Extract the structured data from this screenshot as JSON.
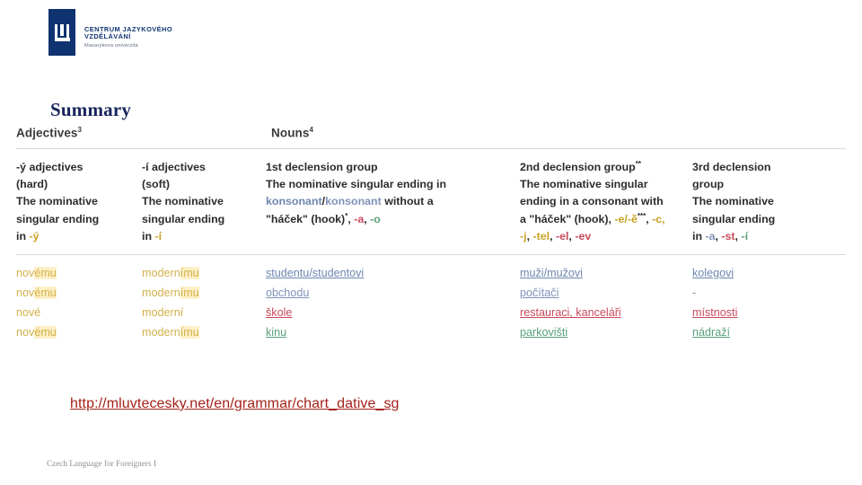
{
  "logo": {
    "line1": "CENTRUM JAZYKOVÉHO",
    "line2": "VZDĚLÁVÁNÍ",
    "line3": "Masarykova univerzita",
    "brand_color": "#0f3370"
  },
  "title": "Summary",
  "table": {
    "headers": {
      "adjectives": "Adjectives",
      "adjectives_sup": "3",
      "nouns": "Nouns",
      "nouns_sup": "4"
    },
    "descriptions": {
      "hard_adj": {
        "l1": "-ý adjectives",
        "l2": "(hard)",
        "l3": "The nominative",
        "l4": "singular ending",
        "l5_prefix": "in ",
        "l5_ending": "-ý"
      },
      "soft_adj": {
        "l1": "-í adjectives",
        "l2": "(soft)",
        "l3": "The nominative",
        "l4": "singular ending",
        "l5_prefix": "in ",
        "l5_ending": "-í"
      },
      "decl1": {
        "l1": "1st declension group",
        "l2": "The nominative singular ending in",
        "l3_a": "konsonant",
        "l3_slash": "/",
        "l3_b": "konsonant",
        "l3_tail": " without a",
        "l4_main": "\"háček\" (hook)",
        "l4_sup": "*",
        "l4_comma": ", ",
        "l4_e1": "-a",
        "l4_sep": ", ",
        "l4_e2": "-o"
      },
      "decl2": {
        "l1": "2nd declension group",
        "l1_sup": "**",
        "l2": "The nominative singular",
        "l3": "ending in a consonant with",
        "l4_main": "a \"háček\" (hook), ",
        "l4_e1": "-e/-ě",
        "l4_sup": "***",
        "l4_sep1": ", ",
        "l4_e2": "-c,",
        "l5_e1": "-j",
        "l5_sep1": ", ",
        "l5_e2": "-tel",
        "l5_sep2": ", ",
        "l5_e3": "-el",
        "l5_sep3": ", ",
        "l5_e4": "-ev"
      },
      "decl3": {
        "l1": "3rd declension",
        "l2": "group",
        "l3": "The nominative",
        "l4": "singular ending",
        "l5_prefix": "in ",
        "l5_e1": "-a",
        "l5_sep1": ", ",
        "l5_e2": "-st",
        "l5_sep2": ", ",
        "l5_e3": "-í"
      }
    },
    "examples": {
      "hard_adj": [
        {
          "stem": "nov",
          "end": "ému"
        },
        {
          "stem": "nov",
          "end": "ému"
        },
        {
          "stem": "nové",
          "end": ""
        },
        {
          "stem": "nov",
          "end": "ému"
        }
      ],
      "soft_adj": [
        {
          "stem": "modern",
          "end": "ímu"
        },
        {
          "stem": "modern",
          "end": "ímu"
        },
        {
          "stem": "moderní",
          "end": ""
        },
        {
          "stem": "modern",
          "end": "ímu"
        }
      ],
      "decl1": [
        {
          "text": "studentu/studentovi",
          "color": "bluedk"
        },
        {
          "text": "obchodu",
          "color": "blue"
        },
        {
          "text": "škole",
          "color": "red"
        },
        {
          "text": "kinu",
          "color": "green"
        }
      ],
      "decl2": [
        {
          "text": "muži/mužovi",
          "color": "bluedk"
        },
        {
          "text": "počítači",
          "color": "blue"
        },
        {
          "text": "restauraci, kanceláři",
          "color": "red"
        },
        {
          "text": "parkovišti",
          "color": "green"
        }
      ],
      "decl3": [
        {
          "text": "kolegovi",
          "color": "bluedk"
        },
        {
          "text": "-",
          "color": "grey"
        },
        {
          "text": "místnosti",
          "color": "red"
        },
        {
          "text": "nádraží",
          "color": "green"
        }
      ]
    }
  },
  "source_link": "http://mluvtecesky.net/en/grammar/chart_dative_sg",
  "footer": "Czech Language for Foreigners I",
  "colors": {
    "brand_navy": "#0f3370",
    "title_navy": "#17255c",
    "link_red": "#a52019",
    "accent_gold": "#c9a227",
    "accent_blue": "#7f93b8",
    "accent_red": "#c94a5a",
    "accent_green": "#5aa17a"
  }
}
